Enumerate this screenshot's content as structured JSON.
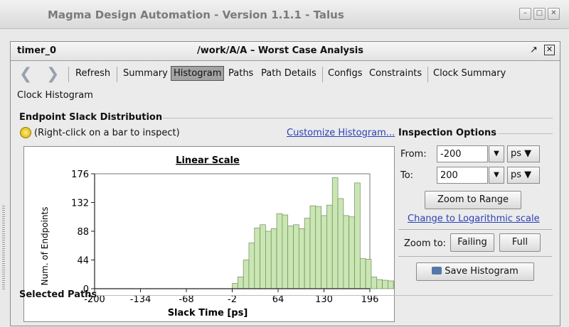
{
  "window": {
    "title": "Magma Design Automation - Version 1.1.1 - Talus",
    "controls": [
      "minimize-icon",
      "maximize-icon",
      "close-icon"
    ]
  },
  "panel": {
    "name": "timer_0",
    "title": "/work/A/A  –  Worst Case Analysis"
  },
  "toolbar": {
    "back_icon": "❮",
    "forward_icon": "❯",
    "items": [
      "Refresh",
      "Summary",
      "Histogram",
      "Paths",
      "Path Details",
      "Configs",
      "Constraints",
      "Clock Summary",
      "Clock Histogram"
    ],
    "active": "Histogram"
  },
  "distribution": {
    "title": "Endpoint Slack Distribution",
    "hint": "(Right-click on a bar to inspect)",
    "customize_link": "Customize Histogram..."
  },
  "chart_data": {
    "type": "bar",
    "title": "Linear Scale",
    "xlabel": "Slack Time [ps]",
    "ylabel": "Num. of Endpoints",
    "xlim": [
      -200,
      196
    ],
    "ylim": [
      0,
      176
    ],
    "xticks": [
      -200,
      -134,
      -68,
      -2,
      64,
      130,
      196
    ],
    "yticks": [
      0,
      44,
      88,
      132,
      176
    ],
    "bin_start": -2,
    "bin_width": 8,
    "values": [
      8,
      18,
      44,
      70,
      93,
      98,
      88,
      92,
      115,
      113,
      96,
      98,
      92,
      108,
      127,
      126,
      112,
      128,
      170,
      138,
      112,
      110,
      162,
      46,
      45,
      18,
      14,
      13,
      12,
      11,
      8,
      7,
      9,
      8,
      10,
      7
    ],
    "bar_color": "#c9e6b3",
    "grid": false
  },
  "inspection": {
    "title": "Inspection Options",
    "from_label": "From:",
    "from_value": "-200",
    "from_unit": "ps",
    "to_label": "To:",
    "to_value": "200",
    "to_unit": "ps",
    "zoom_range": "Zoom to Range",
    "log_link": "Change to Logarithmic scale",
    "zoom_to_label": "Zoom to:",
    "failing": "Failing",
    "full": "Full",
    "save": "Save Histogram"
  },
  "selected_paths": {
    "title": "Selected Paths"
  }
}
